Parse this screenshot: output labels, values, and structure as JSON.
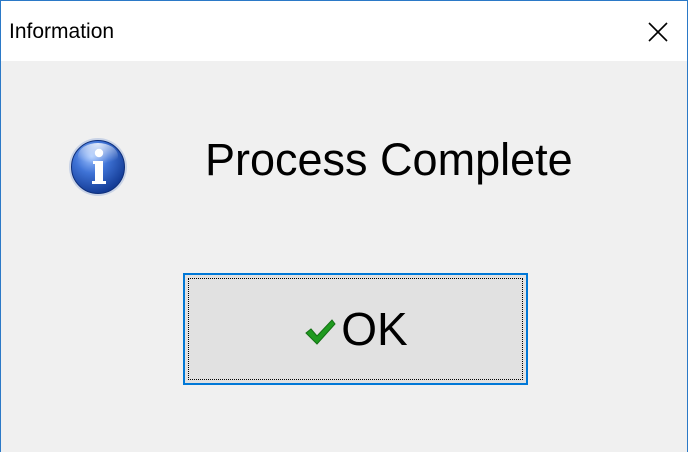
{
  "window": {
    "title": "Information",
    "close_icon": "close-icon"
  },
  "content": {
    "icon": "info-icon",
    "message": "Process Complete"
  },
  "ok_button": {
    "icon": "checkmark-icon",
    "label": "OK"
  },
  "colors": {
    "window_border": "#2b79c7",
    "titlebar_bg": "#ffffff",
    "dialog_bg": "#f0f0f0",
    "button_bg": "#e1e1e1",
    "button_focus_border": "#0078d7",
    "checkmark": "#1f9a1f",
    "info_icon_blue": "#1f4fb0"
  }
}
